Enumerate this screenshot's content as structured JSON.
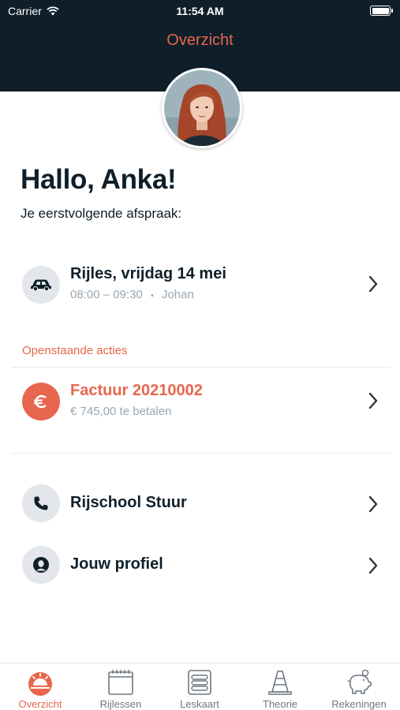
{
  "status_bar": {
    "carrier": "Carrier",
    "time": "11:54 AM"
  },
  "nav": {
    "title": "Overzicht"
  },
  "greeting": "Hallo, Anka!",
  "subtitle": "Je eerstvolgende afspraak:",
  "appointment": {
    "title": "Rijles, vrijdag 14 mei",
    "time": "08:00 – 09:30",
    "separator": "•",
    "instructor": "Johan",
    "icon": "car-icon"
  },
  "open_actions": {
    "label": "Openstaande acties",
    "invoice": {
      "title": "Factuur 20210002",
      "subtitle": "€ 745,00 te betalen",
      "icon": "euro-icon"
    }
  },
  "links": [
    {
      "label": "Rijschool Stuur",
      "icon": "phone-icon"
    },
    {
      "label": "Jouw profiel",
      "icon": "profile-icon"
    }
  ],
  "tabs": [
    {
      "label": "Overzicht",
      "icon": "sunrise-icon",
      "active": true
    },
    {
      "label": "Rijlessen",
      "icon": "calendar-icon",
      "active": false
    },
    {
      "label": "Leskaart",
      "icon": "card-icon",
      "active": false
    },
    {
      "label": "Theorie",
      "icon": "traffic-cone-icon",
      "active": false
    },
    {
      "label": "Rekeningen",
      "icon": "piggy-bank-icon",
      "active": false
    }
  ],
  "colors": {
    "accent": "#e8664e",
    "dark": "#0f1f2a",
    "muted": "#9aa7b2",
    "icon_bg": "#e3e6ea"
  }
}
